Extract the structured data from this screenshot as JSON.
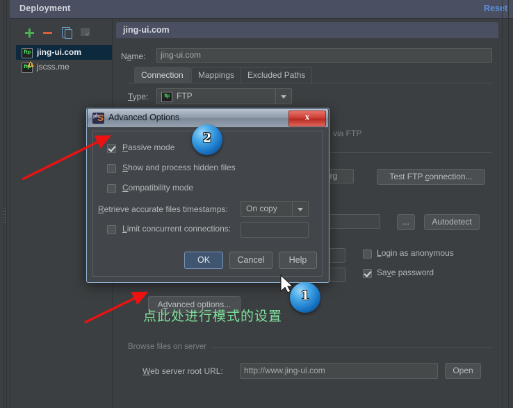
{
  "window": {
    "title": "Deployment",
    "reset_label": "Reset"
  },
  "sidebar": {
    "toolbar": [
      {
        "name": "add",
        "icon": "plus-icon"
      },
      {
        "name": "remove",
        "icon": "minus-icon"
      },
      {
        "name": "copy",
        "icon": "copy-icon"
      },
      {
        "name": "permissions",
        "icon": "permissions-icon"
      }
    ],
    "servers": [
      {
        "label": "jing-ui.com",
        "icon": "ftp-icon",
        "selected": true,
        "warning": false
      },
      {
        "label": "jscss.me",
        "icon": "ftp-icon",
        "selected": false,
        "warning": true
      }
    ]
  },
  "detail": {
    "card_title": "jing-ui.com",
    "name_label": "Name:",
    "name_value": "jing-ui.com",
    "tabs": [
      {
        "label": "Connection",
        "active": true
      },
      {
        "label": "Mappings",
        "active": false
      },
      {
        "label": "Excluded Paths",
        "active": false
      }
    ],
    "type_label": "Type:",
    "type_value": "FTP",
    "upload_hint": "via FTP",
    "host_value": "a.org",
    "test_connection_label": "Test FTP connection...",
    "browse_dots_label": "...",
    "autodetect_label": "Autodetect",
    "login_anonymous_label": "Login as anonymous",
    "login_anonymous_checked": false,
    "save_password_label": "Save password",
    "save_password_checked": true,
    "advanced_options_label": "Advanced options...",
    "browse_section_label": "Browse files on server",
    "web_root_label": "Web server root URL:",
    "web_root_value": "http://www.jing-ui.com",
    "open_label": "Open"
  },
  "dialog": {
    "title": "Advanced Options",
    "app_icon": "phpstorm-icon",
    "close_label": "x",
    "options": [
      {
        "label": "Passive mode",
        "checked": true,
        "mnemonic": "P"
      },
      {
        "label": "Show and process hidden files",
        "checked": false,
        "mnemonic": "S"
      },
      {
        "label": "Compatibility mode",
        "checked": false,
        "mnemonic": "C"
      }
    ],
    "timestamps_label": "Retrieve accurate files timestamps:",
    "timestamps_value": "On copy",
    "limit_label": "Limit concurrent connections:",
    "limit_checked": false,
    "limit_value": "",
    "buttons": [
      {
        "label": "OK",
        "kind": "default"
      },
      {
        "label": "Cancel",
        "kind": "normal"
      },
      {
        "label": "Help",
        "kind": "normal"
      }
    ]
  },
  "annotations": {
    "badge_1": "1",
    "badge_2": "2",
    "note_text": "点此处进行模式的设置",
    "note_color": "#7ee09a",
    "arrow_color": "#ee1111"
  }
}
